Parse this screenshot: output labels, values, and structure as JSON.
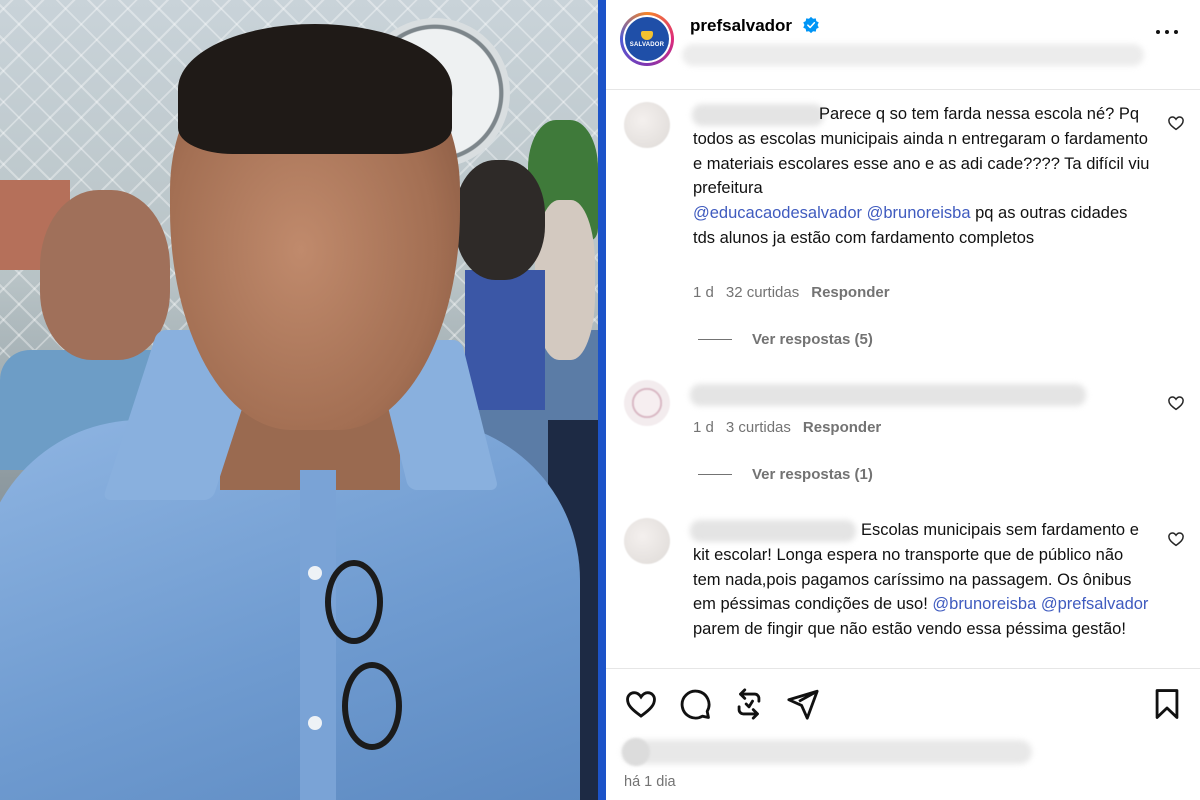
{
  "photo": {
    "description_hidden": false
  },
  "post": {
    "username": "prefsalvador",
    "avatar_text": "SALVADOR",
    "more_icon": "more-horizontal-icon",
    "time_ago": "há 1 dia"
  },
  "comments": [
    {
      "text_before": "Parece q so tem farda nessa escola né? Pq todos as escolas municipais ainda n entregaram o fardamento e materiais escolares esse ano e as adi cade???? Ta difícil viu prefeitura",
      "mention1": "@educacaodesalvador",
      "mention2": "@brunoreisba",
      "text_after": "pq as outras cidades tds alunos ja estão com fardamento completos",
      "time": "1 d",
      "likes": "32 curtidas",
      "reply": "Responder",
      "view_replies": "Ver respostas (5)"
    },
    {
      "time": "1 d",
      "likes": "3 curtidas",
      "reply": "Responder",
      "view_replies": "Ver respostas (1)"
    },
    {
      "text_before": "Escolas municipais sem fardamento e kit escolar! Longa espera no transporte que de público não tem nada,pois pagamos caríssimo na passagem. Os ônibus em péssimas condições de uso!",
      "mention1": "@brunoreisba",
      "mention2": "@prefsalvador",
      "text_after": "parem de fingir que não estão vendo essa péssima gestão!"
    }
  ],
  "colors": {
    "divider": "#1c53c8",
    "mention": "#3f5bbf",
    "meta": "#737373",
    "verified": "#0095f6"
  },
  "icons": [
    "heart-icon",
    "comment-icon",
    "repost-icon",
    "share-icon",
    "bookmark-icon",
    "verified-badge-icon"
  ]
}
